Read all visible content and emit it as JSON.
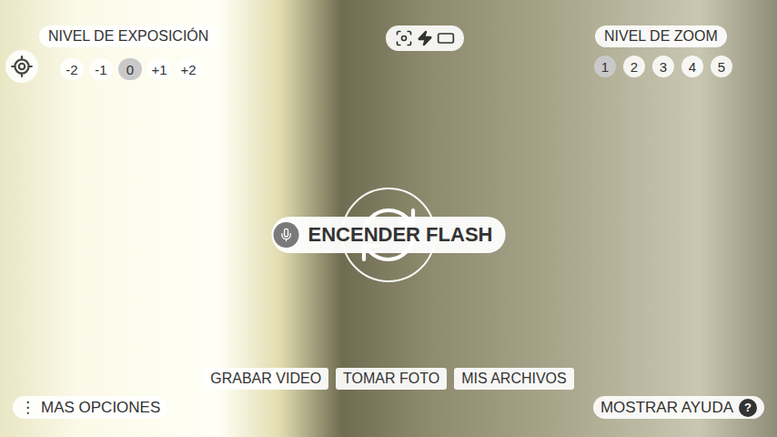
{
  "exposure": {
    "label": "NIVEL DE EXPOSICIÓN",
    "levels": [
      {
        "label": "-2",
        "selected": false
      },
      {
        "label": "-1",
        "selected": false
      },
      {
        "label": "0",
        "selected": true
      },
      {
        "label": "+1",
        "selected": false
      },
      {
        "label": "+2",
        "selected": false
      }
    ]
  },
  "zoom": {
    "label": "NIVEL DE ZOOM",
    "levels": [
      {
        "label": "1",
        "selected": true
      },
      {
        "label": "2",
        "selected": false
      },
      {
        "label": "3",
        "selected": false
      },
      {
        "label": "4",
        "selected": false
      },
      {
        "label": "5",
        "selected": false
      }
    ]
  },
  "voice_command": {
    "label": "ENCENDER FLASH"
  },
  "actions": [
    "GRABAR VIDEO",
    "TOMAR FOTO",
    "MIS ARCHIVOS"
  ],
  "more_options": {
    "icon": "⋮",
    "label": "MAS OPCIONES"
  },
  "help": {
    "label": "MOSTRAR AYUDA",
    "badge": "?"
  }
}
